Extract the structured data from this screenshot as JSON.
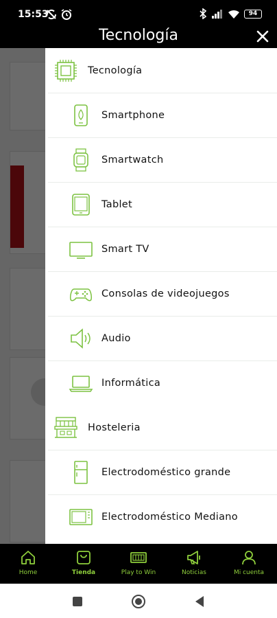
{
  "status": {
    "time": "15:53",
    "battery": "94"
  },
  "header": {
    "title": "Tecnología"
  },
  "drawer": {
    "items": [
      {
        "type": "category",
        "label": "Tecnología",
        "icon": "chip-icon"
      },
      {
        "type": "sub",
        "label": "Smartphone",
        "icon": "smartphone-icon"
      },
      {
        "type": "sub",
        "label": "Smartwatch",
        "icon": "smartwatch-icon"
      },
      {
        "type": "sub",
        "label": "Tablet",
        "icon": "tablet-icon"
      },
      {
        "type": "sub",
        "label": "Smart TV",
        "icon": "tv-icon"
      },
      {
        "type": "sub",
        "label": "Consolas de videojuegos",
        "icon": "gamepad-icon"
      },
      {
        "type": "sub",
        "label": "Audio",
        "icon": "speaker-icon"
      },
      {
        "type": "sub",
        "label": "Informática",
        "icon": "laptop-icon"
      },
      {
        "type": "category",
        "label": "Hosteleria",
        "icon": "storefront-icon"
      },
      {
        "type": "sub",
        "label": "Electrodoméstico grande",
        "icon": "fridge-icon"
      },
      {
        "type": "sub",
        "label": "Electrodoméstico Mediano",
        "icon": "microwave-icon"
      }
    ]
  },
  "bottom_nav": [
    {
      "label": "Home",
      "icon": "home-icon"
    },
    {
      "label": "Tienda",
      "icon": "shopping-bag-icon",
      "active": true
    },
    {
      "label": "Play to Win",
      "icon": "ticket-icon"
    },
    {
      "label": "Noticias",
      "icon": "megaphone-icon"
    },
    {
      "label": "Mi cuenta",
      "icon": "user-icon"
    }
  ],
  "colors": {
    "accent": "#8fcf3c",
    "icon_green": "#7cc241"
  }
}
